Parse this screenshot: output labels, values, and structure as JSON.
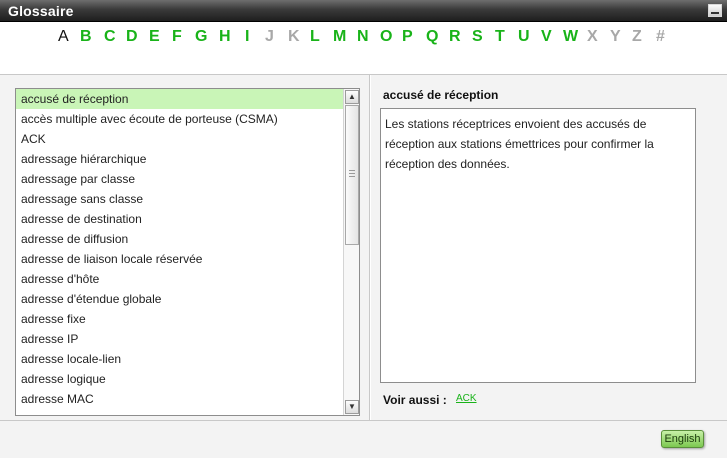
{
  "window": {
    "title": "Glossaire"
  },
  "alphabet": [
    {
      "ch": "A",
      "state": "current"
    },
    {
      "ch": "B",
      "state": "enabled"
    },
    {
      "ch": "C",
      "state": "enabled"
    },
    {
      "ch": "D",
      "state": "enabled"
    },
    {
      "ch": "E",
      "state": "enabled"
    },
    {
      "ch": "F",
      "state": "enabled"
    },
    {
      "ch": "G",
      "state": "enabled"
    },
    {
      "ch": "H",
      "state": "enabled"
    },
    {
      "ch": "I",
      "state": "enabled"
    },
    {
      "ch": "J",
      "state": "disabled"
    },
    {
      "ch": "K",
      "state": "disabled"
    },
    {
      "ch": "L",
      "state": "enabled"
    },
    {
      "ch": "M",
      "state": "enabled"
    },
    {
      "ch": "N",
      "state": "enabled"
    },
    {
      "ch": "O",
      "state": "enabled"
    },
    {
      "ch": "P",
      "state": "enabled"
    },
    {
      "ch": "Q",
      "state": "enabled"
    },
    {
      "ch": "R",
      "state": "enabled"
    },
    {
      "ch": "S",
      "state": "enabled"
    },
    {
      "ch": "T",
      "state": "enabled"
    },
    {
      "ch": "U",
      "state": "enabled"
    },
    {
      "ch": "V",
      "state": "enabled"
    },
    {
      "ch": "W",
      "state": "enabled"
    },
    {
      "ch": "X",
      "state": "disabled"
    },
    {
      "ch": "Y",
      "state": "disabled"
    },
    {
      "ch": "Z",
      "state": "disabled"
    },
    {
      "ch": "#",
      "state": "disabled"
    }
  ],
  "terms": [
    "accusé de réception",
    "accès multiple avec écoute de porteuse (CSMA)",
    "ACK",
    "adressage hiérarchique",
    "adressage par classe",
    "adressage sans classe",
    "adresse de destination",
    "adresse de diffusion",
    "adresse de liaison locale réservée",
    "adresse d'hôte",
    "adresse d'étendue globale",
    "adresse fixe",
    "adresse IP",
    "adresse locale-lien",
    "adresse logique",
    "adresse MAC"
  ],
  "selected_index": 0,
  "definition": {
    "term": "accusé de réception",
    "text": "Les stations réceptrices envoient des accusés de réception aux stations émettrices pour confirmer la réception des données.",
    "see_also_label": "Voir aussi :",
    "see_also_link": "ACK"
  },
  "footer": {
    "language_button": "English"
  },
  "icons": {
    "minimize": "minimize-icon",
    "scroll_up": "scroll-up-arrow-icon",
    "scroll_down": "scroll-down-arrow-icon"
  },
  "colors": {
    "enabled_letter": "#19b319",
    "disabled_letter": "#a8a8a8",
    "selected_row": "#c9f5b7"
  }
}
